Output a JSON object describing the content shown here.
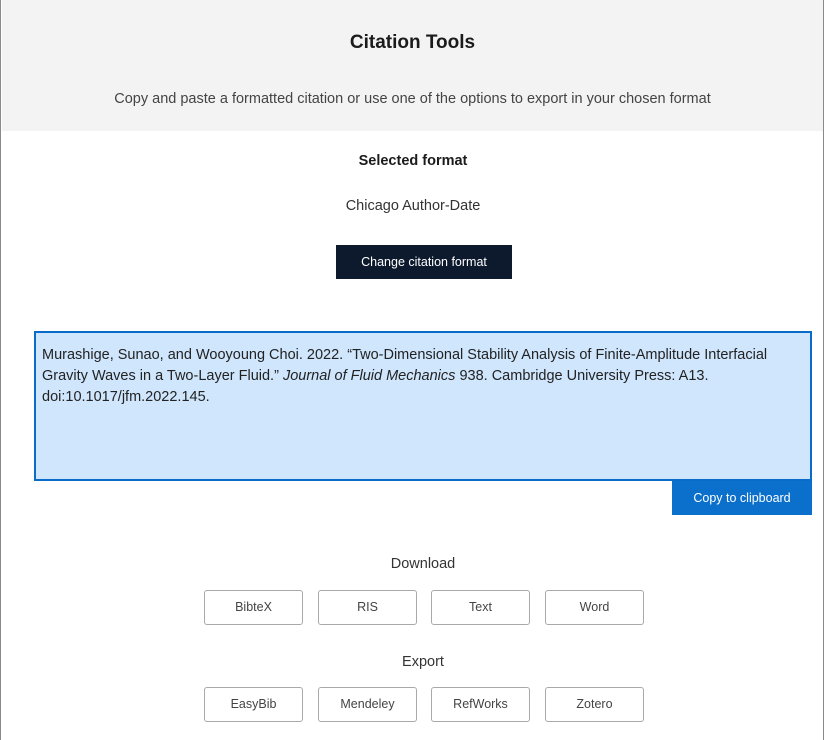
{
  "header": {
    "title": "Citation Tools",
    "subtitle": "Copy and paste a formatted citation or use one of the options to export in your chosen format"
  },
  "format": {
    "label": "Selected format",
    "value": "Chicago Author-Date",
    "change_button": "Change citation format"
  },
  "citation": {
    "before_journal": "Murashige, Sunao, and Wooyoung Choi. 2022. “Two-Dimensional Stability Analysis of Finite-Amplitude Interfacial Gravity Waves in a Two-Layer Fluid.” ",
    "journal": "Journal of Fluid Mechanics",
    "after_journal": " 938. Cambridge University Press: A13. doi:10.1017/jfm.2022.145.",
    "copy_button": "Copy to clipboard"
  },
  "download": {
    "label": "Download",
    "buttons": [
      "BibteX",
      "RIS",
      "Text",
      "Word"
    ]
  },
  "export": {
    "label": "Export",
    "buttons": [
      "EasyBib",
      "Mendeley",
      "RefWorks",
      "Zotero"
    ]
  },
  "colors": {
    "header_bg": "#f3f3f3",
    "primary_dark": "#0d1a2e",
    "accent_blue": "#0b6fcc",
    "citation_bg": "#cfe6fd"
  }
}
